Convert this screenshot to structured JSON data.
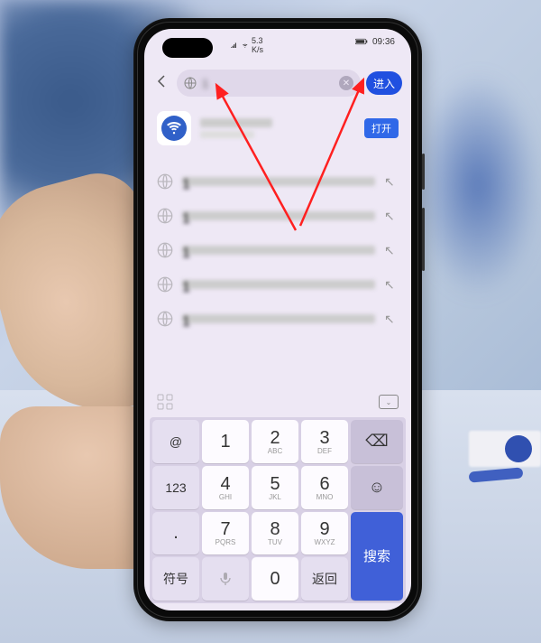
{
  "status_bar": {
    "network_speed": "5.3 K/s",
    "time": "09:36",
    "battery_icon": "battery-90"
  },
  "address_bar": {
    "back_icon": "chevron-left",
    "globe_icon": "globe",
    "typed_text": "1",
    "clear_icon": "close",
    "enter_label": "进入"
  },
  "top_suggestion": {
    "icon": "wifi-app",
    "open_label": "打开"
  },
  "history_count": 5,
  "history_arrow": "↖",
  "keyboard": {
    "toolbar_grid": "apps-grid",
    "toolbar_collapse": "collapse-keyboard",
    "row_left": [
      "@",
      "123",
      ".",
      "符号"
    ],
    "numpad": [
      {
        "n": "1",
        "s": ""
      },
      {
        "n": "2",
        "s": "ABC"
      },
      {
        "n": "3",
        "s": "DEF"
      },
      {
        "n": "4",
        "s": "GHI"
      },
      {
        "n": "5",
        "s": "JKL"
      },
      {
        "n": "6",
        "s": "MNO"
      },
      {
        "n": "7",
        "s": "PQRS"
      },
      {
        "n": "8",
        "s": "TUV"
      },
      {
        "n": "9",
        "s": "WXYZ"
      }
    ],
    "bottom_mic": "mic",
    "bottom_zero": "0",
    "bottom_return": "返回",
    "right_col": {
      "backspace": "⌫",
      "emoji": "☺",
      "search": "搜索"
    }
  },
  "annotations": {
    "arrow_color": "#ff2020"
  }
}
